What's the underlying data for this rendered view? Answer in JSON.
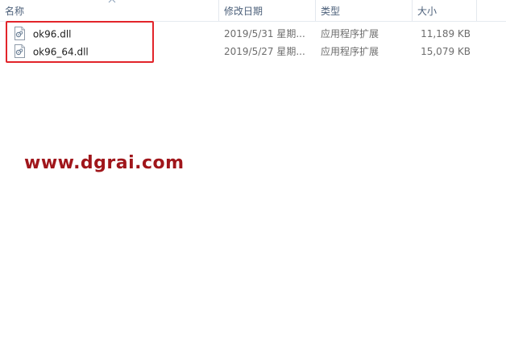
{
  "columns": {
    "name": "名称",
    "date": "修改日期",
    "type": "类型",
    "size": "大小"
  },
  "files": [
    {
      "name": "ok96.dll",
      "date": "2019/5/31 星期...",
      "type": "应用程序扩展",
      "size": "11,189 KB"
    },
    {
      "name": "ok96_64.dll",
      "date": "2019/5/27 星期...",
      "type": "应用程序扩展",
      "size": "15,079 KB"
    }
  ],
  "watermark": "www.dgrai.com",
  "icons": {
    "file": "dll-file-icon",
    "sort": "sort-up-icon"
  },
  "colors": {
    "highlight": "#e2242a",
    "watermark": "#a0161b",
    "header_text": "#4c607a"
  }
}
